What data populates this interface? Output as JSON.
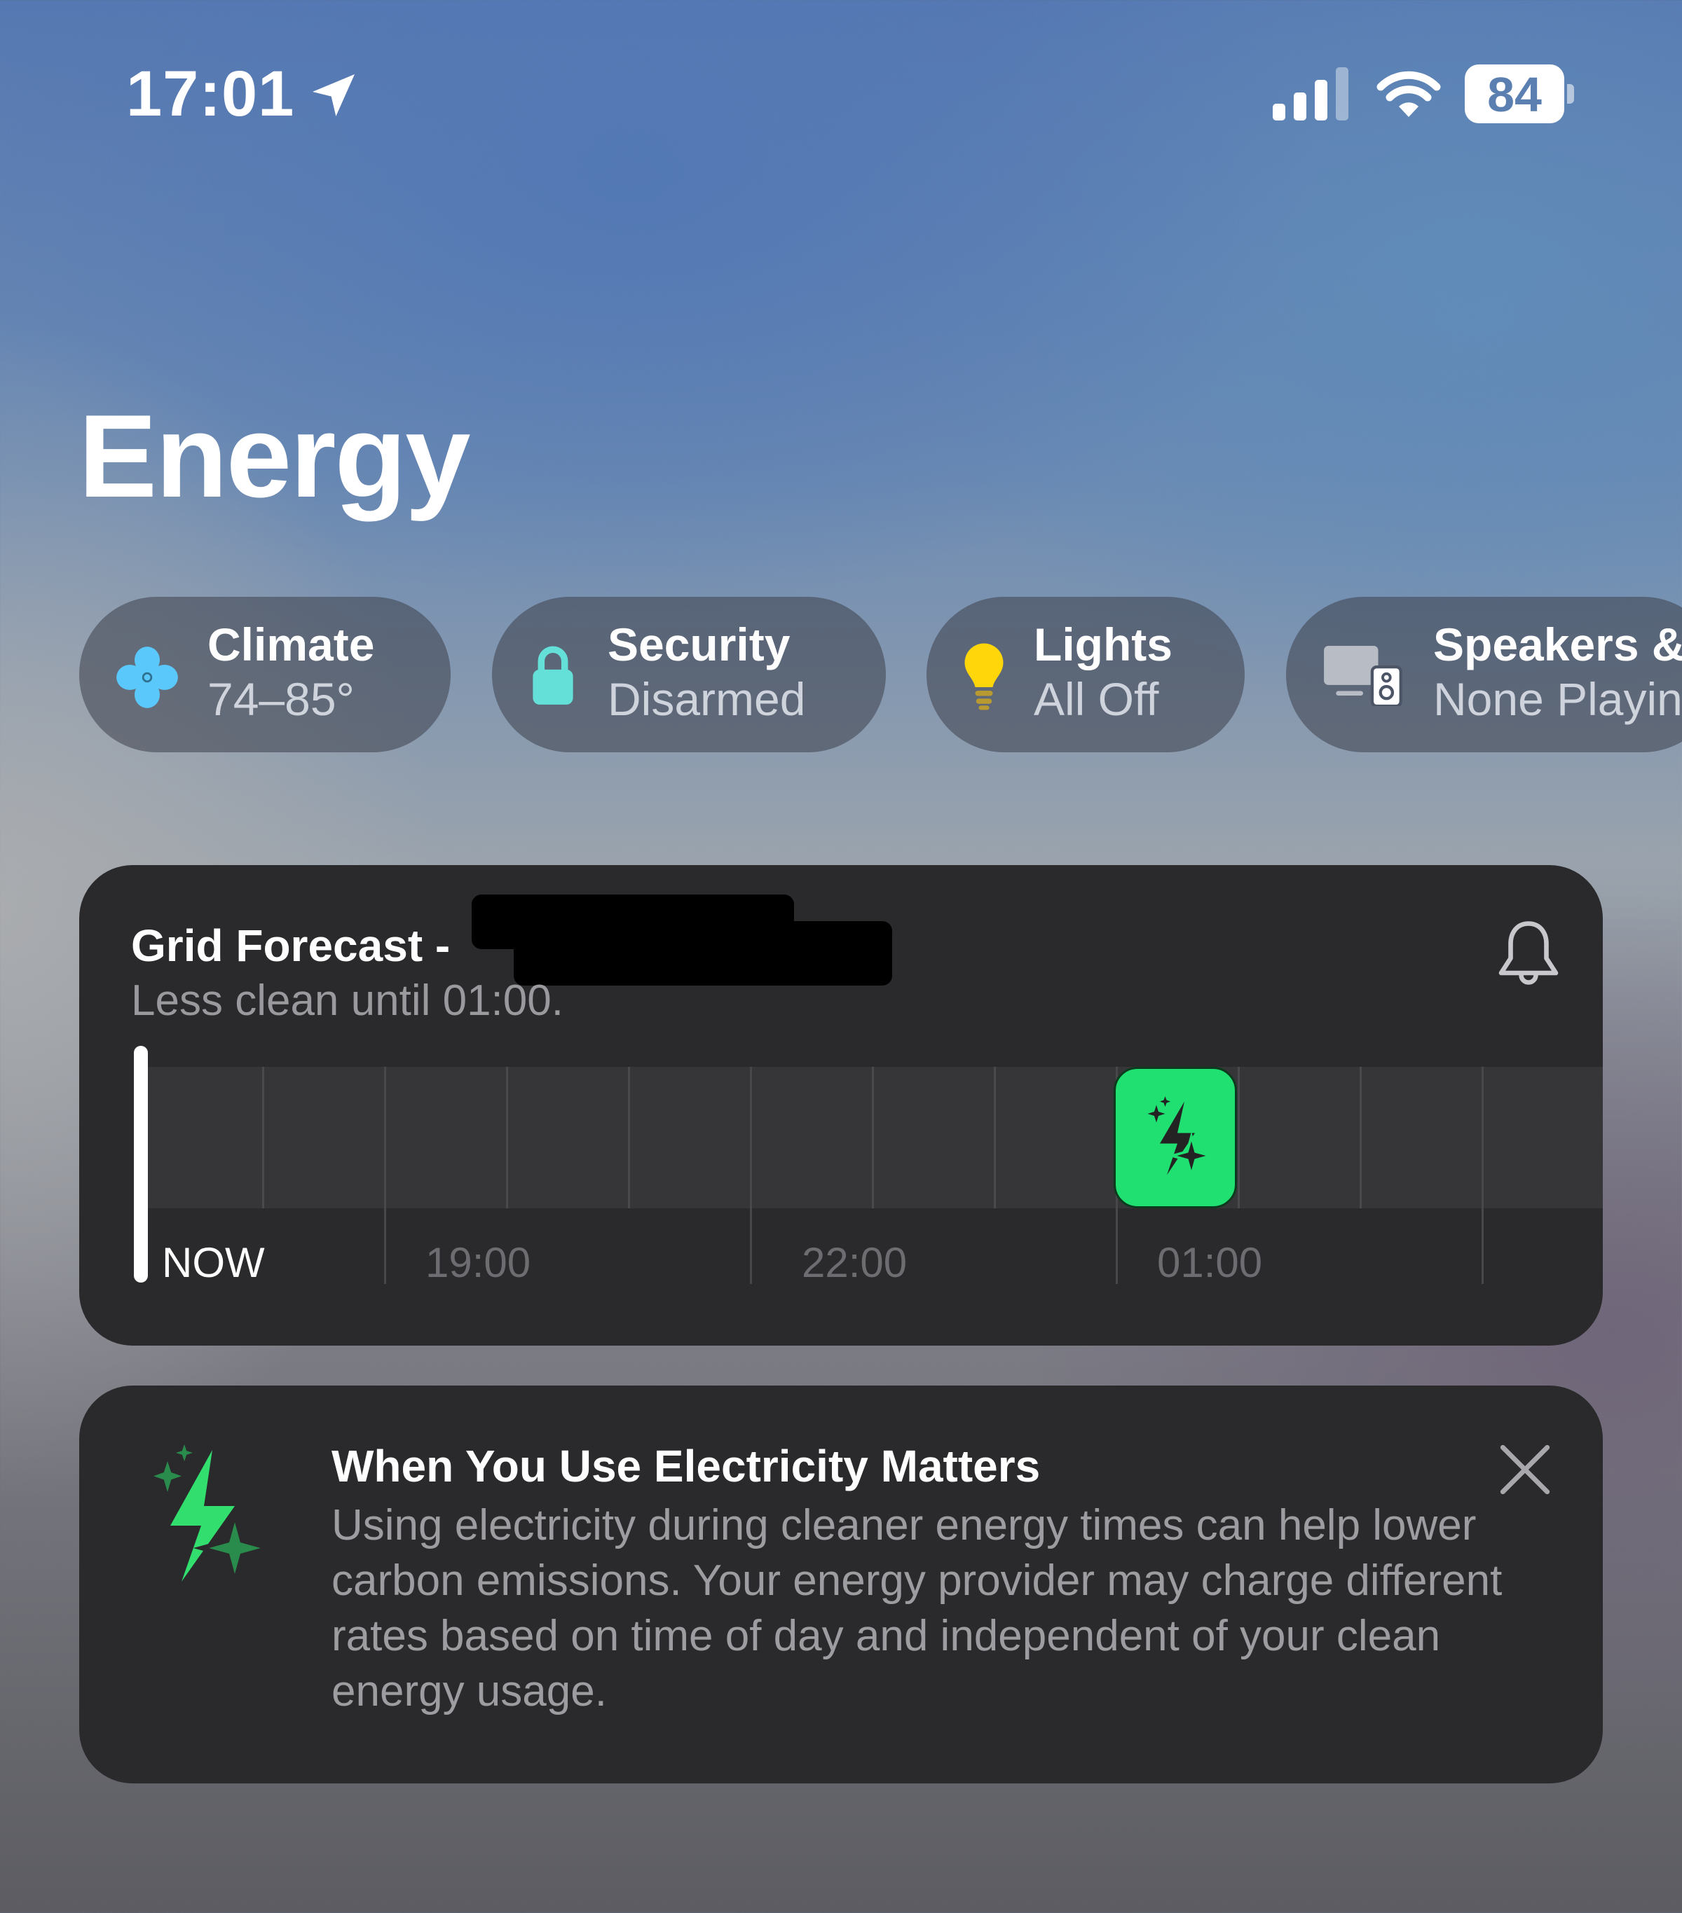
{
  "status_bar": {
    "time": "17:01",
    "location_icon": "location-arrow-icon",
    "signal_icon": "cellular-signal-icon",
    "wifi_icon": "wifi-icon",
    "battery_percent": "84"
  },
  "page": {
    "title": "Energy"
  },
  "category_pills": [
    {
      "icon": "fan-icon",
      "label": "Climate",
      "status": "74–85°",
      "icon_color": "#5ac8fa"
    },
    {
      "icon": "lock-icon",
      "label": "Security",
      "status": "Disarmed",
      "icon_color": "#64e0d8"
    },
    {
      "icon": "lightbulb-icon",
      "label": "Lights",
      "status": "All Off",
      "icon_color": "#ffd60a"
    },
    {
      "icon": "speaker-tv-icon",
      "label": "Speakers &",
      "status": "None Playin"
    }
  ],
  "grid_forecast": {
    "title": "Grid Forecast -",
    "subtitle": "Less clean until 01:00.",
    "bell_icon": "bell-icon",
    "timeline": {
      "now_label": "NOW",
      "labels": [
        "19:00",
        "22:00",
        "01:00"
      ],
      "hour_start_offset": 0,
      "total_hours": 12,
      "clean_window": {
        "start_hour": "01:00",
        "end_hour": "02:00",
        "color": "#1fe070",
        "icon": "clean-energy-sparkle-icon"
      }
    }
  },
  "tip_card": {
    "icon": "clean-energy-sparkle-icon",
    "title": "When You Use Electricity Matters",
    "body": "Using electricity during cleaner energy times can help lower carbon emissions. Your energy provider may charge different rates based on time of day and independent of your clean energy usage.",
    "close_icon": "close-icon"
  }
}
